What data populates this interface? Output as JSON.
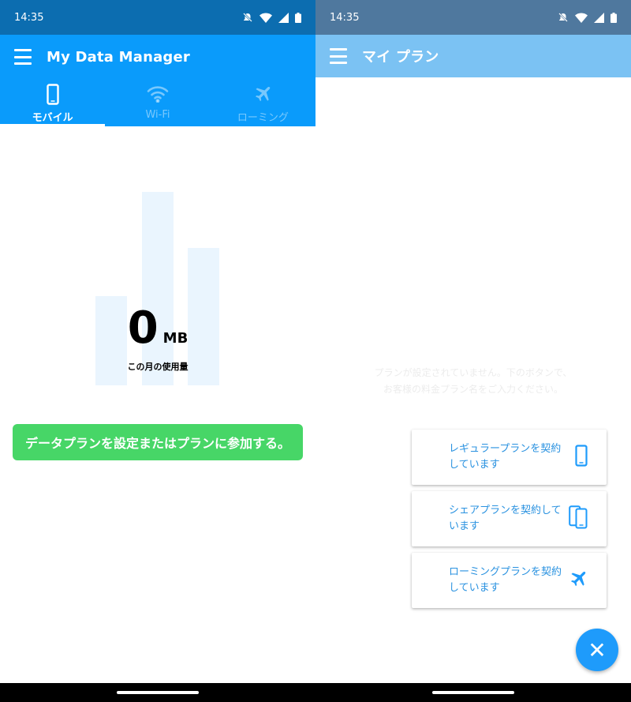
{
  "left_screen": {
    "status_time": "14:35",
    "app_title": "My Data Manager",
    "tabs": [
      {
        "label": "モバイル",
        "icon": "phone-icon",
        "active": true
      },
      {
        "label": "Wi-Fi",
        "icon": "wifi-icon",
        "active": false
      },
      {
        "label": "ローミング",
        "icon": "airplane-icon",
        "active": false
      }
    ],
    "usage_value": "0",
    "usage_unit": "MB",
    "usage_caption": "この月の使用量",
    "cta_label": "データプランを設定またはプランに参加する。",
    "colors": {
      "appbar": "#0a9bfb",
      "statusbar": "#0c6db0",
      "cta": "#47d667",
      "bar": "#eaf5fe"
    }
  },
  "right_screen": {
    "status_time": "14:35",
    "app_title": "マイ プラン",
    "empty_line1": "プランが設定されていません。下のボタンで、",
    "empty_line2": "お客様の料金プラン名をご入力ください。",
    "plan_cards": [
      {
        "label": "レギュラープランを契約しています",
        "icon": "phone-icon"
      },
      {
        "label": "シェアプランを契約しています",
        "icon": "dual-phone-icon"
      },
      {
        "label": "ローミングプランを契約しています",
        "icon": "airplane-icon"
      }
    ],
    "fab_symbol": "✕",
    "colors": {
      "appbar": "#7bc2f3",
      "statusbar": "#4f789e",
      "fab": "#1e9bfb",
      "card_text": "#2a92e0"
    }
  }
}
